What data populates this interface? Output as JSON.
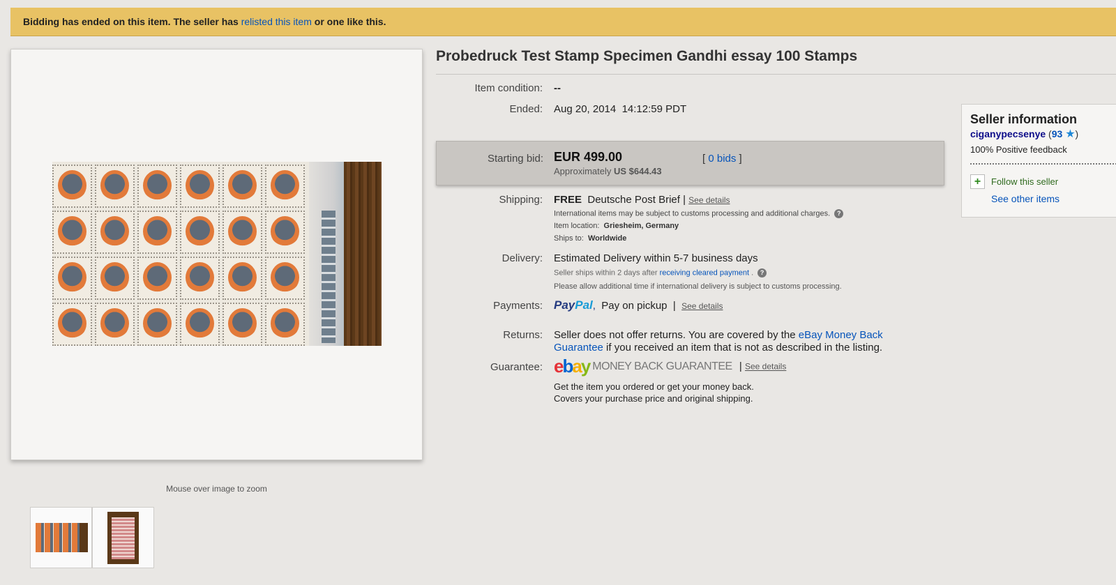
{
  "banner": {
    "text_before": "Bidding has ended on this item. The seller has ",
    "link": "relisted this item",
    "text_after": " or one like this."
  },
  "gallery": {
    "zoom_hint": "Mouse over image to zoom"
  },
  "item": {
    "title": "Probedruck Test Stamp Specimen Gandhi essay 100 Stamps"
  },
  "details": {
    "condition_label": "Item condition:",
    "condition_value": "--",
    "ended_label": "Ended:",
    "ended_value": "Aug 20, 2014  14:12:59 PDT",
    "bid_label": "Starting bid:",
    "bid_price": "EUR 499.00",
    "bid_approx_prefix": "Approximately ",
    "bid_approx_value": "US $644.43",
    "bids_open": "[ ",
    "bids_link": "0 bids",
    "bids_close": " ]",
    "shipping_label": "Shipping:",
    "shipping_free": "FREE",
    "shipping_method": "Deutsche Post Brief |",
    "shipping_details": "See details",
    "shipping_note": "International items may be subject to customs processing and additional charges.",
    "location_label": "Item location:",
    "location_value": "Griesheim, Germany",
    "ships_to_label": "Ships to:",
    "ships_to_value": "Worldwide",
    "delivery_label": "Delivery:",
    "delivery_value": "Estimated Delivery within 5-7 business days",
    "delivery_note_prefix": "Seller ships within 2 days after ",
    "delivery_note_link": "receiving cleared payment",
    "delivery_note_suffix": " .",
    "delivery_note2": "Please allow additional time if international delivery is subject to customs processing.",
    "payments_label": "Payments:",
    "paypal_part1": "Pay",
    "paypal_part2": "Pal",
    "payments_value": "Pay on pickup",
    "payments_sep": "|",
    "payments_details": "See details",
    "returns_label": "Returns:",
    "returns_text1": "Seller does not offer returns. You are covered by the ",
    "returns_link": "eBay Money Back Guarantee",
    "returns_text2": " if you received an item that is not as described in the listing.",
    "guarantee_label": "Guarantee:",
    "ebay_e": "e",
    "ebay_b": "b",
    "ebay_a": "a",
    "ebay_y": "y",
    "mbg_text": "MONEY BACK GUARANTEE",
    "guarantee_sep": "|",
    "guarantee_details": "See details",
    "guarantee_line1": "Get the item you ordered or get your money back.",
    "guarantee_line2": "Covers your purchase price and original shipping."
  },
  "seller": {
    "heading": "Seller information",
    "name": "ciganypecsenye",
    "count_open": " (",
    "count": "93",
    "star": "★",
    "count_close": ")",
    "feedback": "100% Positive feedback",
    "follow_icon": "+",
    "follow": "Follow this seller",
    "other_items": "See other items"
  },
  "icons": {
    "help": "?"
  }
}
